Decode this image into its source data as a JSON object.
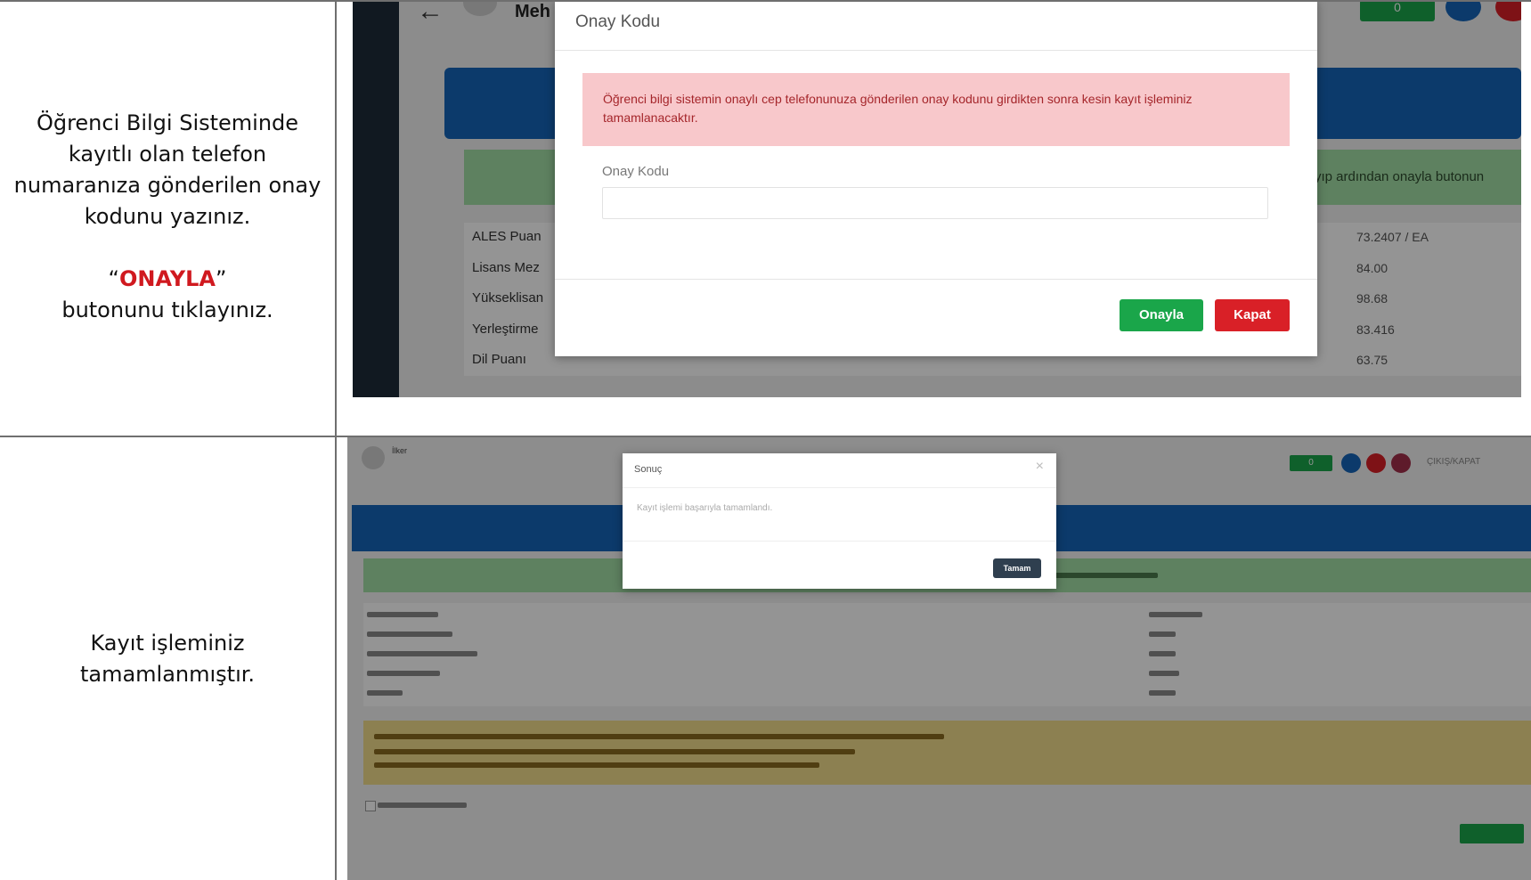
{
  "step1": {
    "instruction_lines": [
      "Öğrenci Bilgi Sisteminde",
      "kayıtlı olan telefon",
      "numaranıza gönderilen onay",
      "kodunu yazınız."
    ],
    "quote_open": "“",
    "highlight": "ONAYLA",
    "quote_close": "”",
    "instruction_tail": "butonunu tıklayınız.",
    "screenshot": {
      "header_name": "Meh",
      "header_badge": "0",
      "green_bar_text": "yıp ardından onayla butonun",
      "rows": [
        {
          "label": "ALES Puan",
          "value": "73.2407 / EA"
        },
        {
          "label": "Lisans Mez",
          "value": "84.00"
        },
        {
          "label": "Yükseklisan",
          "value": "98.68"
        },
        {
          "label": "Yerleştirme",
          "value": "83.416"
        },
        {
          "label": "Dil Puanı",
          "value": "63.75"
        }
      ],
      "modal": {
        "title": "Onay Kodu",
        "alert_text": "Öğrenci bilgi sistemin onaylı cep telefonunuza gönderilen onay kodunu girdikten sonra kesin kayıt işleminiz tamamlanacaktır.",
        "field_label": "Onay Kodu",
        "field_value": "",
        "confirm_label": "Onayla",
        "close_label": "Kapat"
      }
    }
  },
  "step2": {
    "instruction_lines": [
      "Kayıt işleminiz",
      "tamamlanmıştır."
    ],
    "screenshot": {
      "header_name": "İlker",
      "header_user": "ÇIKIŞ/KAPAT",
      "header_badge": "0",
      "modal": {
        "title": "Sonuç",
        "close_glyph": "×",
        "message": "Kayıt işlemi başarıyla tamamlandı.",
        "ok_label": "Tamam"
      }
    }
  },
  "colors": {
    "primary_blue": "#1565b8",
    "green": "#1aa64a",
    "red": "#d92027",
    "alert_bg": "#f8c8cb",
    "dark_nav": "#1e2b3a"
  }
}
